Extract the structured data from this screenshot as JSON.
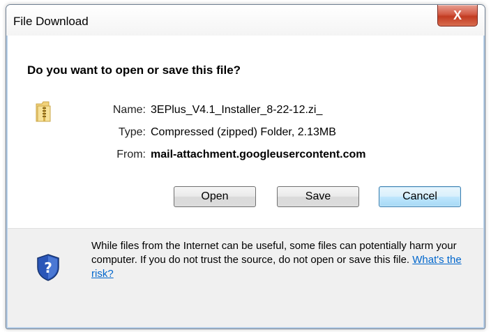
{
  "window": {
    "title": "File Download",
    "close_symbol": "X"
  },
  "dialog": {
    "question": "Do you want to open or save this file?",
    "icon": "zip-folder-icon",
    "fields": {
      "name_label": "Name:",
      "name_value": "3EPlus_V4.1_Installer_8-22-12.zi_",
      "type_label": "Type:",
      "type_value": "Compressed (zipped) Folder, 2.13MB",
      "from_label": "From:",
      "from_value": "mail-attachment.googleusercontent.com"
    },
    "buttons": {
      "open": "Open",
      "save": "Save",
      "cancel": "Cancel"
    },
    "warning": {
      "icon": "security-shield-question-icon",
      "text": "While files from the Internet can be useful, some files can potentially harm your computer. If you do not trust the source, do not open or save this file.",
      "link": "What's the risk?"
    }
  }
}
